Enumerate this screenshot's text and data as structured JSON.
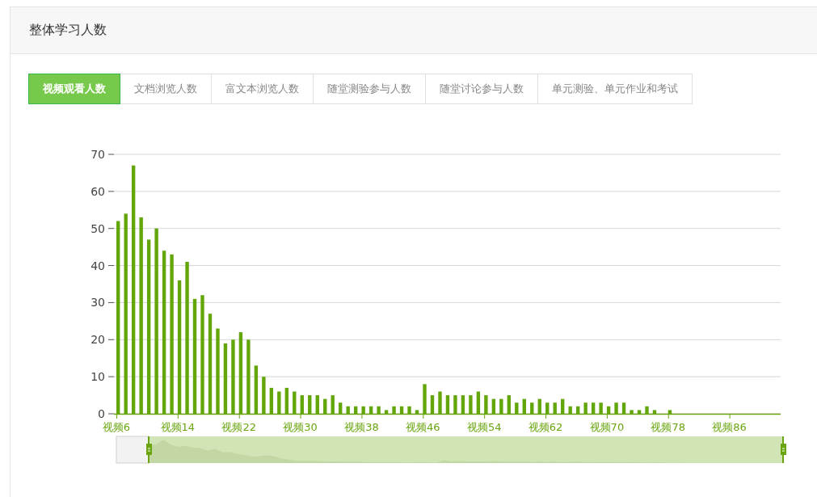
{
  "panel": {
    "title": "整体学习人数"
  },
  "tabs": [
    {
      "label": "视频观看人数",
      "selected": true
    },
    {
      "label": "文档浏览人数",
      "selected": false
    },
    {
      "label": "富文本浏览人数",
      "selected": false
    },
    {
      "label": "随堂测验参与人数",
      "selected": false
    },
    {
      "label": "随堂讨论参与人数",
      "selected": false
    },
    {
      "label": "单元测验、单元作业和考试",
      "selected": false
    }
  ],
  "chart": {
    "chart_data": {
      "type": "bar",
      "grid": true,
      "categories": [
        "视频6",
        null,
        null,
        null,
        null,
        null,
        null,
        null,
        "视频14",
        null,
        null,
        null,
        null,
        null,
        null,
        null,
        "视频22",
        null,
        null,
        null,
        null,
        null,
        null,
        null,
        "视频30",
        null,
        null,
        null,
        null,
        null,
        null,
        null,
        "视频38",
        null,
        null,
        null,
        null,
        null,
        null,
        null,
        "视频46",
        null,
        null,
        null,
        null,
        null,
        null,
        null,
        "视频54",
        null,
        null,
        null,
        null,
        null,
        null,
        null,
        "视频62",
        null,
        null,
        null,
        null,
        null,
        null,
        null,
        "视频70",
        null,
        null,
        null,
        null,
        null,
        null,
        null,
        "视频78",
        null,
        null,
        null,
        null,
        null,
        null,
        null,
        "视频86",
        null,
        null,
        null,
        null,
        null,
        null
      ],
      "series": [
        {
          "color": "#62a60a",
          "values": [
            52,
            54,
            67,
            53,
            47,
            50,
            44,
            43,
            36,
            41,
            31,
            32,
            27,
            23,
            19,
            20,
            22,
            20,
            13,
            10,
            7,
            6,
            7,
            6,
            5,
            5,
            5,
            4,
            5,
            3,
            2,
            2,
            2,
            2,
            2,
            1,
            2,
            2,
            2,
            1,
            8,
            5,
            6,
            5,
            5,
            5,
            5,
            6,
            5,
            4,
            4,
            5,
            3,
            4,
            3,
            4,
            3,
            3,
            4,
            2,
            2,
            3,
            3,
            3,
            2,
            3,
            3,
            1,
            1,
            2,
            1,
            0,
            1,
            0,
            0,
            0,
            0,
            0,
            0,
            0,
            0,
            0,
            0,
            0,
            0,
            0,
            0
          ]
        }
      ],
      "ylim": [
        0,
        70
      ],
      "yticks": [
        0,
        10,
        20,
        30,
        40,
        50,
        60,
        70
      ]
    }
  }
}
